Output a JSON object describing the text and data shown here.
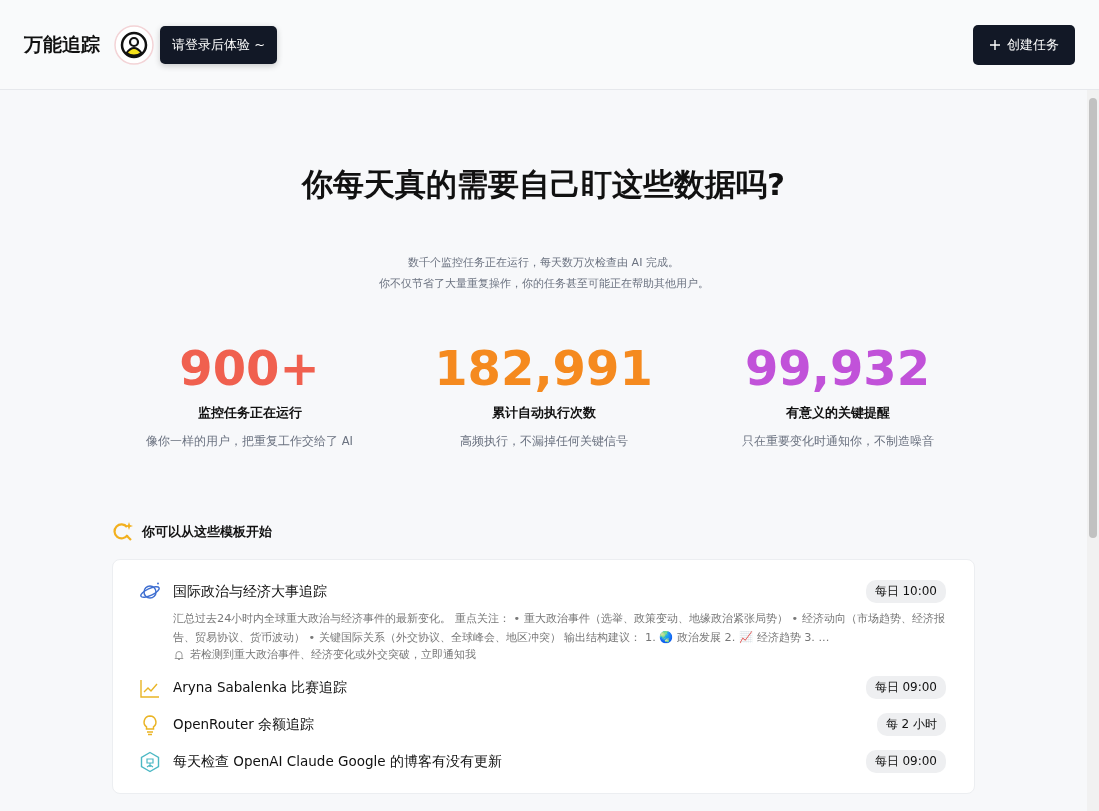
{
  "header": {
    "logo": "万能追踪",
    "login_hint": "请登录后体验 ~",
    "create_button": "创建任务"
  },
  "hero": {
    "title": "你每天真的需要自己盯这些数据吗?",
    "subtitle_lines": [
      "数千个监控任务正在运行，每天数万次检查由 AI 完成。",
      "你不仅节省了大量重复操作，你的任务甚至可能正在帮助其他用户。"
    ]
  },
  "stats": [
    {
      "value": "900+",
      "label": "监控任务正在运行",
      "description": "像你一样的用户，把重复工作交给了 AI",
      "color": "#f0604f"
    },
    {
      "value": "182,991",
      "label": "累计自动执行次数",
      "description": "高频执行，不漏掉任何关键信号",
      "color": "#f58a1f"
    },
    {
      "value": "99,932",
      "label": "有意义的关键提醒",
      "description": "只在重要变化时通知你，不制造噪音",
      "color": "#c152d9"
    }
  ],
  "templates": {
    "heading": "你可以从这些模板开始",
    "items": [
      {
        "title": "国际政治与经济大事追踪",
        "schedule": "每日 10:00",
        "description": "汇总过去24小时内全球重大政治与经济事件的最新变化。 重点关注： • 重大政治事件（选举、政策变动、地缘政治紧张局势） • 经济动向（市场趋势、经济报告、贸易协议、货币波动） • 关键国际关系（外交协议、全球峰会、地区冲突） 输出结构建议： 1. 🌏 政治发展 2. 📈 经济趋势 3. ...",
        "notify": "若检测到重大政治事件、经济变化或外交突破，立即通知我"
      },
      {
        "title": "Aryna Sabalenka 比赛追踪",
        "schedule": "每日 09:00"
      },
      {
        "title": "OpenRouter 余额追踪",
        "schedule": "每 2 小时"
      },
      {
        "title": "每天检查 OpenAI Claude Google 的博客有没有更新",
        "schedule": "每日 09:00"
      }
    ]
  }
}
